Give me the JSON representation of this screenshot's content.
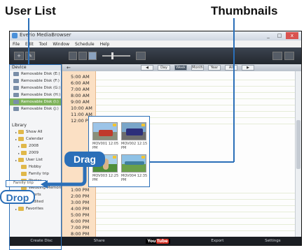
{
  "callouts": {
    "user_list": "User List",
    "thumbnails": "Thumbnails",
    "drag": "Drag",
    "drop": "Drop"
  },
  "window": {
    "title": "Everio MediaBrowser",
    "buttons": {
      "minimize": "_",
      "maximize": "□",
      "close": "x"
    }
  },
  "menu": [
    "File",
    "Edit",
    "Tool",
    "Window",
    "Schedule",
    "Help"
  ],
  "toolbar": {
    "add": "+",
    "edit": "✎"
  },
  "sidebar": {
    "device_header": "Device",
    "device_items": [
      "Removable Disk (E:)",
      "Removable Disk (F:)",
      "Removable Disk (G:)",
      "Removable Disk (H:)",
      "Removable Disk (I:)",
      "Removable Disk (J:)"
    ],
    "selected_index": 4,
    "library_header": "Library",
    "library_items": [
      {
        "label": "Show All",
        "type": "lib"
      },
      {
        "label": "Calendar",
        "type": "lib"
      },
      {
        "label": "2008",
        "type": "sub"
      },
      {
        "label": "2009",
        "type": "sub"
      },
      {
        "label": "User List",
        "type": "lib"
      },
      {
        "label": "Hobby",
        "type": "sub2"
      },
      {
        "label": "Family trip",
        "type": "sub2"
      },
      {
        "label": "Photos",
        "type": "sub2"
      },
      {
        "label": "Wedding Memories",
        "type": "sub2"
      },
      {
        "label": "Sports",
        "type": "sub2"
      },
      {
        "label": "Unedited",
        "type": "lib"
      },
      {
        "label": "Favorites",
        "type": "lib"
      }
    ],
    "drop_target": "Family trip"
  },
  "nav": {
    "back": "←",
    "buttons": [
      "◀",
      "Day",
      "Week",
      "Month",
      "Year",
      "All",
      "▶"
    ]
  },
  "times": [
    "5:00 AM",
    "6:00 AM",
    "7:00 AM",
    "8:00 AM",
    "9:00 AM",
    "10:00 AM",
    "11:00 AM",
    "12:00 PM",
    "1:00 PM",
    "2:00 PM",
    "3:00 PM",
    "4:00 PM",
    "5:00 PM",
    "6:00 PM",
    "7:00 PM",
    "8:00 PM"
  ],
  "thumbnails": [
    {
      "caption": "MOV001 12:05 PM",
      "scene": "car"
    },
    {
      "caption": "MOV002 12:15 PM",
      "scene": "racecar"
    },
    {
      "caption": "MOV003 12:25 PM",
      "scene": "person"
    },
    {
      "caption": "MOV004 12:35 PM",
      "scene": "landscape"
    }
  ],
  "bottom_bar": {
    "create_disc": "Create Disc",
    "share": "Share",
    "youtube": "YouTube",
    "export": "Export",
    "settings": "Settings"
  },
  "colors": {
    "accent": "#2b6fb8",
    "time_column": "#fbe0c4",
    "selected": "#7fb35b"
  }
}
